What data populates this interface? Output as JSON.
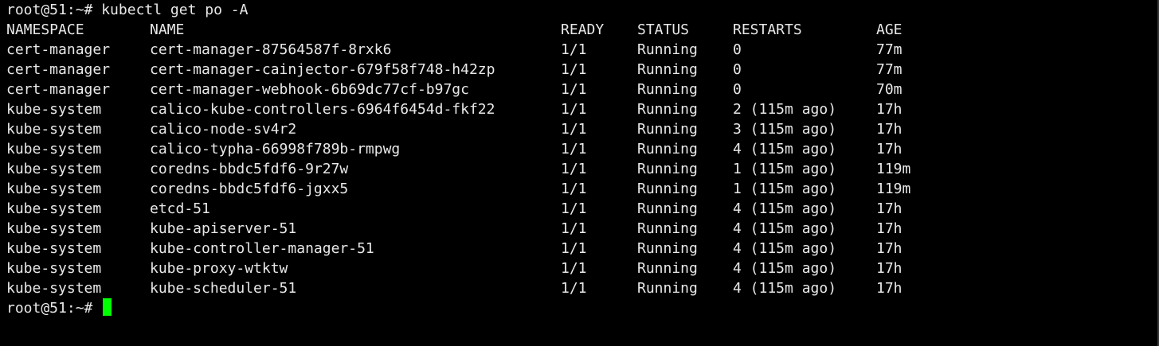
{
  "terminal": {
    "command_prompt": "root@51:~# ",
    "command": "kubectl get po -A",
    "final_prompt": "root@51:~# ",
    "cursor_color": "#00ff00",
    "headers": {
      "namespace": "NAMESPACE",
      "name": "NAME",
      "ready": "READY",
      "status": "STATUS",
      "restarts": "RESTARTS",
      "age": "AGE"
    },
    "rows": [
      {
        "namespace": "cert-manager",
        "name": "cert-manager-87564587f-8rxk6",
        "ready": "1/1",
        "status": "Running",
        "restarts": "0",
        "age": "77m"
      },
      {
        "namespace": "cert-manager",
        "name": "cert-manager-cainjector-679f58f748-h42zp",
        "ready": "1/1",
        "status": "Running",
        "restarts": "0",
        "age": "77m"
      },
      {
        "namespace": "cert-manager",
        "name": "cert-manager-webhook-6b69dc77cf-b97gc",
        "ready": "1/1",
        "status": "Running",
        "restarts": "0",
        "age": "70m"
      },
      {
        "namespace": "kube-system",
        "name": "calico-kube-controllers-6964f6454d-fkf22",
        "ready": "1/1",
        "status": "Running",
        "restarts": "2 (115m ago)",
        "age": "17h"
      },
      {
        "namespace": "kube-system",
        "name": "calico-node-sv4r2",
        "ready": "1/1",
        "status": "Running",
        "restarts": "3 (115m ago)",
        "age": "17h"
      },
      {
        "namespace": "kube-system",
        "name": "calico-typha-66998f789b-rmpwg",
        "ready": "1/1",
        "status": "Running",
        "restarts": "4 (115m ago)",
        "age": "17h"
      },
      {
        "namespace": "kube-system",
        "name": "coredns-bbdc5fdf6-9r27w",
        "ready": "1/1",
        "status": "Running",
        "restarts": "1 (115m ago)",
        "age": "119m"
      },
      {
        "namespace": "kube-system",
        "name": "coredns-bbdc5fdf6-jgxx5",
        "ready": "1/1",
        "status": "Running",
        "restarts": "1 (115m ago)",
        "age": "119m"
      },
      {
        "namespace": "kube-system",
        "name": "etcd-51",
        "ready": "1/1",
        "status": "Running",
        "restarts": "4 (115m ago)",
        "age": "17h"
      },
      {
        "namespace": "kube-system",
        "name": "kube-apiserver-51",
        "ready": "1/1",
        "status": "Running",
        "restarts": "4 (115m ago)",
        "age": "17h"
      },
      {
        "namespace": "kube-system",
        "name": "kube-controller-manager-51",
        "ready": "1/1",
        "status": "Running",
        "restarts": "4 (115m ago)",
        "age": "17h"
      },
      {
        "namespace": "kube-system",
        "name": "kube-proxy-wtktw",
        "ready": "1/1",
        "status": "Running",
        "restarts": "4 (115m ago)",
        "age": "17h"
      },
      {
        "namespace": "kube-system",
        "name": "kube-scheduler-51",
        "ready": "1/1",
        "status": "Running",
        "restarts": "4 (115m ago)",
        "age": "17h"
      }
    ]
  }
}
